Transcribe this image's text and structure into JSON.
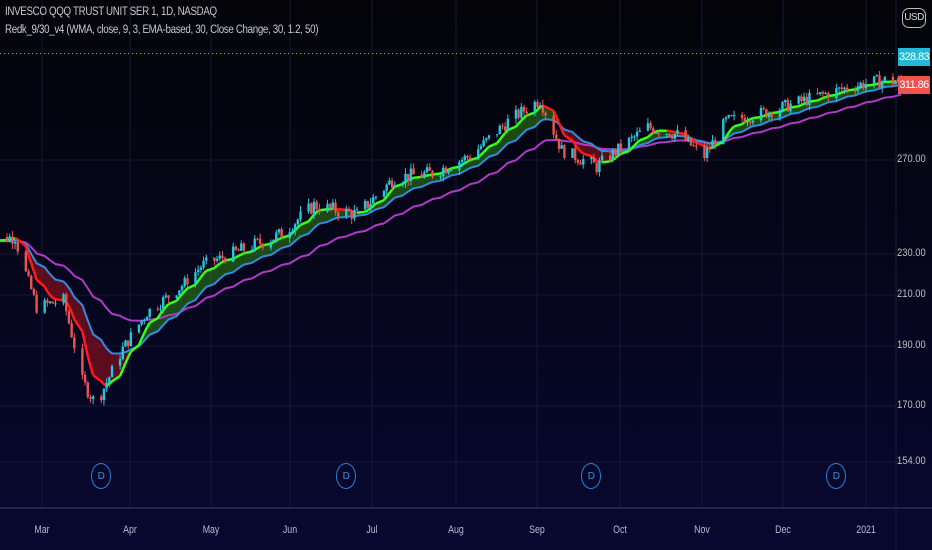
{
  "header": {
    "symbol_line": "INVESCO QQQ TRUST UNIT SER 1, 1D, NASDAQ",
    "indicator_line": "Redk_9/30_v4 (WMA, close, 9, 3, EMA-based, 30, Close Change, 30, 1.2, 50)",
    "currency": "USD"
  },
  "price_labels": {
    "line_value": "328.83",
    "line_color": "#22b8d8",
    "last_price": "311.86",
    "last_color": "#ef5350"
  },
  "dividend_marker": "D",
  "chart_data": {
    "type": "candlestick",
    "scale": "log",
    "grid": true,
    "y_ticks": [
      "270.00",
      "230.00",
      "210.00",
      "190.00",
      "170.00",
      "154.00"
    ],
    "y_tick_values": [
      270,
      230,
      210,
      190,
      170,
      154
    ],
    "x_ticks": [
      "Mar",
      "Apr",
      "May",
      "Jun",
      "Jul",
      "Aug",
      "Sep",
      "Oct",
      "Nov",
      "Dec",
      "2021"
    ],
    "dividend_dates": [
      "2020-03-23",
      "2020-06-22",
      "2020-09-21",
      "2020-12-21"
    ],
    "closes": [
      [
        "2020-02-10",
        235
      ],
      [
        "2020-02-20",
        237
      ],
      [
        "2020-02-28",
        205
      ],
      [
        "2020-03-09",
        208
      ],
      [
        "2020-03-16",
        178
      ],
      [
        "2020-03-20",
        172
      ],
      [
        "2020-03-23",
        174
      ],
      [
        "2020-03-31",
        189
      ],
      [
        "2020-04-09",
        203
      ],
      [
        "2020-04-20",
        212
      ],
      [
        "2020-04-30",
        225
      ],
      [
        "2020-05-15",
        232
      ],
      [
        "2020-05-29",
        238
      ],
      [
        "2020-06-10",
        250
      ],
      [
        "2020-06-26",
        246
      ],
      [
        "2020-07-10",
        262
      ],
      [
        "2020-07-24",
        264
      ],
      [
        "2020-08-07",
        272
      ],
      [
        "2020-08-21",
        290
      ],
      [
        "2020-09-02",
        302
      ],
      [
        "2020-09-10",
        275
      ],
      [
        "2020-09-23",
        267
      ],
      [
        "2020-10-12",
        287
      ],
      [
        "2020-10-23",
        283
      ],
      [
        "2020-11-02",
        272
      ],
      [
        "2020-11-10",
        290
      ],
      [
        "2020-11-25",
        295
      ],
      [
        "2020-12-10",
        302
      ],
      [
        "2020-12-28",
        310
      ],
      [
        "2021-01-08",
        313
      ],
      [
        "2021-01-14",
        311.86
      ]
    ],
    "colors": {
      "up": "#26c6da",
      "down": "#ef5350",
      "fast_up": "#39ff14",
      "fast_down": "#ff1a1a",
      "slow": "#2f8de0",
      "ema50": "#b03ac8"
    }
  }
}
